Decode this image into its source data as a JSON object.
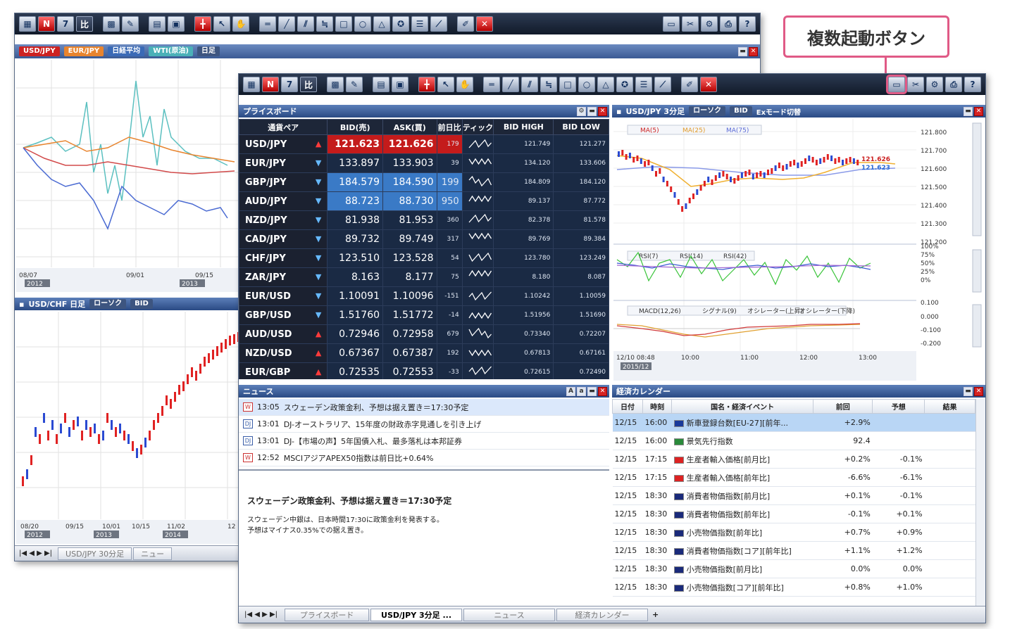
{
  "callout": {
    "label": "複数起動ボタン"
  },
  "back_window": {
    "tabs": [
      "USD/JPY",
      "EUR/JPY",
      "日経平均",
      "WTI(原油)",
      "日足"
    ],
    "top_chart_dates": [
      "08/07",
      "09/01",
      "09/15"
    ],
    "top_chart_years": [
      "2012",
      "2013"
    ],
    "lower_title": "USD/CHF 日足",
    "lower_ctl": [
      "ローソク",
      "BID"
    ],
    "lower_dates": [
      "08/20",
      "09/15",
      "10/01",
      "10/15",
      "11/02",
      "12"
    ],
    "lower_years": [
      "2012",
      "2013",
      "2014"
    ],
    "bottom_tabs": [
      "USD/JPY 30分足",
      "ニュー"
    ]
  },
  "front_window": {
    "priceboard": {
      "title": "プライスボード",
      "headers": [
        "通貨ペア",
        "BID(売)",
        "ASK(買)",
        "前日比",
        "ティック",
        "BID HIGH",
        "BID LOW"
      ],
      "rows": [
        {
          "pair": "USD/JPY",
          "dir": "up",
          "bid": "121.623",
          "ask": "121.626",
          "chg": "179",
          "high": "121.749",
          "low": "121.277",
          "hl": "red"
        },
        {
          "pair": "EUR/JPY",
          "dir": "dn",
          "bid": "133.897",
          "ask": "133.903",
          "chg": "39",
          "high": "134.120",
          "low": "133.606",
          "hl": ""
        },
        {
          "pair": "GBP/JPY",
          "dir": "dn",
          "bid": "184.579",
          "ask": "184.590",
          "chg": "199",
          "high": "184.809",
          "low": "184.120",
          "hl": "blue"
        },
        {
          "pair": "AUD/JPY",
          "dir": "dn",
          "bid": "88.723",
          "ask": "88.730",
          "chg": "950",
          "high": "89.137",
          "low": "87.772",
          "hl": "blue"
        },
        {
          "pair": "NZD/JPY",
          "dir": "dn",
          "bid": "81.938",
          "ask": "81.953",
          "chg": "360",
          "high": "82.378",
          "low": "81.578",
          "hl": ""
        },
        {
          "pair": "CAD/JPY",
          "dir": "dn",
          "bid": "89.732",
          "ask": "89.749",
          "chg": "317",
          "high": "89.769",
          "low": "89.384",
          "hl": ""
        },
        {
          "pair": "CHF/JPY",
          "dir": "dn",
          "bid": "123.510",
          "ask": "123.528",
          "chg": "54",
          "high": "123.780",
          "low": "123.249",
          "hl": ""
        },
        {
          "pair": "ZAR/JPY",
          "dir": "dn",
          "bid": "8.163",
          "ask": "8.177",
          "chg": "75",
          "high": "8.180",
          "low": "8.087",
          "hl": ""
        },
        {
          "pair": "EUR/USD",
          "dir": "dn",
          "bid": "1.10091",
          "ask": "1.10096",
          "chg": "-151",
          "high": "1.10242",
          "low": "1.10059",
          "hl": ""
        },
        {
          "pair": "GBP/USD",
          "dir": "dn",
          "bid": "1.51760",
          "ask": "1.51772",
          "chg": "-14",
          "high": "1.51956",
          "low": "1.51690",
          "hl": ""
        },
        {
          "pair": "AUD/USD",
          "dir": "up",
          "bid": "0.72946",
          "ask": "0.72958",
          "chg": "679",
          "high": "0.73340",
          "low": "0.72207",
          "hl": ""
        },
        {
          "pair": "NZD/USD",
          "dir": "up",
          "bid": "0.67367",
          "ask": "0.67387",
          "chg": "192",
          "high": "0.67813",
          "low": "0.67161",
          "hl": ""
        },
        {
          "pair": "EUR/GBP",
          "dir": "up",
          "bid": "0.72535",
          "ask": "0.72553",
          "chg": "-33",
          "high": "0.72615",
          "low": "0.72490",
          "hl": ""
        }
      ]
    },
    "chart": {
      "title": "USD/JPY 3分足",
      "ctl": [
        "ローソク",
        "BID",
        "Exモード切替"
      ],
      "ma_legend": [
        "MA(5)",
        "MA(25)",
        "MA(75)"
      ],
      "rsi_legend": [
        "RSI(7)",
        "RSI(14)",
        "RSI(42)"
      ],
      "macd_legend": [
        "MACD(12,26)",
        "シグナル(9)",
        "オシレーター(上昇)",
        "オシレーター(下降)"
      ],
      "price_ticks": [
        "121.800",
        "121.700",
        "121.600",
        "121.500",
        "121.400",
        "121.300",
        "121.200"
      ],
      "price_ask": "121.626",
      "price_bid": "121.623",
      "rsi_ticks": [
        "100%",
        "75%",
        "50%",
        "25%",
        "0%"
      ],
      "macd_ticks": [
        "0.100",
        "0.000",
        "-0.100",
        "-0.200"
      ],
      "time_ticks": [
        "12/10 08:48",
        "10:00",
        "11:00",
        "12:00",
        "13:00"
      ],
      "year": "2015/12"
    },
    "news": {
      "title": "ニュース",
      "items": [
        {
          "time": "13:05",
          "text": "スウェーデン政策金利、予想は据え置き＝17:30予定",
          "icon": "W"
        },
        {
          "time": "13:01",
          "text": "DJ-オーストラリア、15年度の財政赤字見通しを引き上げ",
          "icon": "DJ"
        },
        {
          "time": "13:01",
          "text": "DJ-【市場の声】5年国債入札、最多落札は本邦証券",
          "icon": "DJ"
        },
        {
          "time": "12:52",
          "text": "MSCIアジアAPEX50指数は前日比+0.64%",
          "icon": "W"
        }
      ],
      "detail_title": "スウェーデン政策金利、予想は据え置き＝17:30予定",
      "detail_body_1": "スウェーデン中銀は、日本時間17:30に政策金利を発表する。",
      "detail_body_2": "予想はマイナス0.35%での据え置き。"
    },
    "calendar": {
      "title": "経済カレンダー",
      "headers": [
        "日付",
        "時刻",
        "国名・経済イベント",
        "前回",
        "予想",
        "結果"
      ],
      "rows": [
        {
          "date": "12/15",
          "time": "16:00",
          "flag": "eu",
          "event": "新車登録台数[EU-27][前年...",
          "prev": "+2.9%",
          "fc": "",
          "res": ""
        },
        {
          "date": "12/15",
          "time": "16:00",
          "flag": "za",
          "event": "景気先行指数",
          "prev": "92.4",
          "fc": "",
          "res": ""
        },
        {
          "date": "12/15",
          "time": "17:15",
          "flag": "ch",
          "event": "生産者輸入価格[前月比]",
          "prev": "+0.2%",
          "fc": "-0.1%",
          "res": ""
        },
        {
          "date": "12/15",
          "time": "17:15",
          "flag": "ch",
          "event": "生産者輸入価格[前年比]",
          "prev": "-6.6%",
          "fc": "-6.1%",
          "res": ""
        },
        {
          "date": "12/15",
          "time": "18:30",
          "flag": "uk",
          "event": "消費者物価指数[前月比]",
          "prev": "+0.1%",
          "fc": "-0.1%",
          "res": ""
        },
        {
          "date": "12/15",
          "time": "18:30",
          "flag": "uk",
          "event": "消費者物価指数[前年比]",
          "prev": "-0.1%",
          "fc": "+0.1%",
          "res": ""
        },
        {
          "date": "12/15",
          "time": "18:30",
          "flag": "uk",
          "event": "小売物価指数[前年比]",
          "prev": "+0.7%",
          "fc": "+0.9%",
          "res": ""
        },
        {
          "date": "12/15",
          "time": "18:30",
          "flag": "uk",
          "event": "消費者物価指数[コア][前年比]",
          "prev": "+1.1%",
          "fc": "+1.2%",
          "res": ""
        },
        {
          "date": "12/15",
          "time": "18:30",
          "flag": "uk",
          "event": "小売物価指数[前月比]",
          "prev": "0.0%",
          "fc": "0.0%",
          "res": ""
        },
        {
          "date": "12/15",
          "time": "18:30",
          "flag": "uk",
          "event": "小売物価指数[コア][前年比]",
          "prev": "+0.8%",
          "fc": "+1.0%",
          "res": ""
        }
      ]
    },
    "bottom_tabs": [
      "プライスボード",
      "USD/JPY 3分足 ...",
      "ニュース",
      "経済カレンダー"
    ]
  },
  "colors": {
    "accent_pink": "#e05a86",
    "bid_red": "#c41b1b",
    "ask_blue": "#3a7ac6",
    "navy": "#1a2a44"
  }
}
